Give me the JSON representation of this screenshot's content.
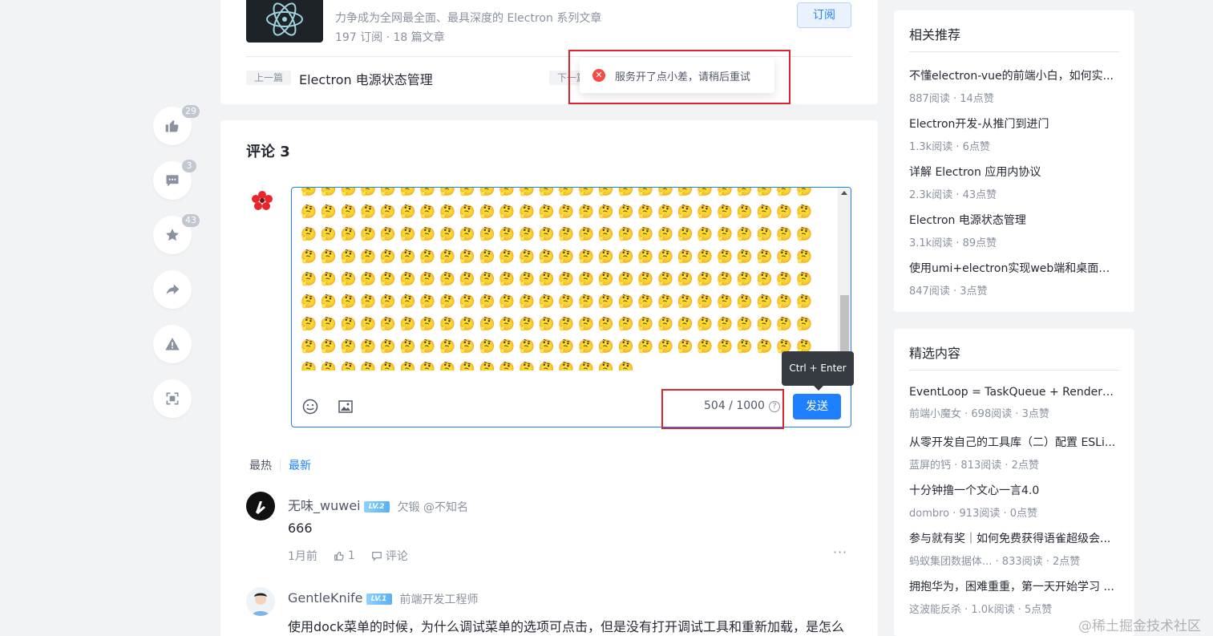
{
  "action_bar": {
    "like_count": "29",
    "comment_count": "3",
    "collect_count": "43"
  },
  "column": {
    "description": "力争成为全网最全面、最具深度的 Electron 系列文章",
    "meta": "197 订阅 · 18 篇文章",
    "subscribe_label": "订阅"
  },
  "article_nav": {
    "prev_tag": "上一篇",
    "prev_title": "Electron 电源状态管理",
    "next_tag": "下一篇"
  },
  "toast": {
    "message": "服务开了点小差，请稍后重试"
  },
  "comments": {
    "title": "评论 3",
    "editor": {
      "content": "🤔🤔🤔🤔🤔🤔🤔🤔🤔🤔🤔🤔🤔🤔🤔🤔🤔🤔🤔🤔🤔🤔🤔🤔🤔🤔🤔🤔🤔🤔🤔🤔🤔🤔🤔🤔🤔🤔🤔🤔🤔🤔🤔🤔🤔🤔🤔🤔🤔🤔🤔🤔🤔🤔🤔🤔🤔🤔🤔🤔🤔🤔🤔🤔🤔🤔🤔🤔🤔🤔🤔🤔🤔🤔🤔🤔🤔🤔🤔🤔🤔🤔🤔🤔🤔🤔🤔🤔🤔🤔🤔🤔🤔🤔🤔🤔🤔🤔🤔🤔🤔🤔🤔🤔🤔🤔🤔🤔🤔🤔🤔🤔🤔🤔🤔🤔🤔🤔🤔🤔🤔🤔🤔🤔🤔🤔🤔🤔🤔🤔🤔🤔🤔🤔🤔🤔🤔🤔🤔🤔🤔🤔🤔🤔🤔🤔🤔🤔🤔🤔🤔🤔🤔🤔🤔🤔🤔🤔🤔🤔🤔🤔🤔🤔🤔🤔🤔🤔🤔🤔🤔🤔🤔🤔🤔🤔🤔🤔🤔🤔🤔🤔🤔🤔🤔🤔🤔🤔🤔🤔🤔🤔🤔🤔🤔🤔🤔🤔🤔🤔🤔🤔🤔🤔🤔🤔🤔🤔🤔🤔🤔🤔🤔🤔🤔🤔🤔🤔🤔🤔🤔🤔🤔🤔🤔",
      "counter": "504 / 1000",
      "send_label": "发送",
      "tooltip": "Ctrl + Enter"
    },
    "sort": {
      "hot": "最热",
      "new": "最新"
    },
    "items": [
      {
        "username": "无味_wuwei",
        "level": "LV.2",
        "job": "欠锻 @不知名",
        "text": "666",
        "time": "1月前",
        "likes": "1",
        "reply_label": "评论"
      },
      {
        "username": "GentleKnife",
        "level": "LV.1",
        "job": "前端开发工程师",
        "text": "使用dock菜单的时候，为什么调试菜单的选项可点击，但是没有打开调试工具和重新加载，是怎么"
      }
    ]
  },
  "sidebar": {
    "related": {
      "title": "相关推荐",
      "items": [
        {
          "title": "不懂electron-vue的前端小白，如何实...",
          "meta": "887阅读 · 14点赞"
        },
        {
          "title": "Electron开发-从推门到进门",
          "meta": "1.3k阅读 · 6点赞"
        },
        {
          "title": "详解 Electron 应用内协议",
          "meta": "2.3k阅读 · 43点赞"
        },
        {
          "title": "Electron 电源状态管理",
          "meta": "3.1k阅读 · 89点赞"
        },
        {
          "title": "使用umi+electron实现web端和桌面端...",
          "meta": "847阅读 · 3点赞"
        }
      ]
    },
    "featured": {
      "title": "精选内容",
      "items": [
        {
          "title": "EventLoop = TaskQueue + RenderQu...",
          "meta": "前端小魔女 · 698阅读 · 3点赞"
        },
        {
          "title": "从零开发自己的工具库（二）配置 ESLi...",
          "meta": "蓝屏的钙 · 813阅读 · 2点赞"
        },
        {
          "title": "十分钟撸一个文心一言4.0",
          "meta": "dombro · 913阅读 · 0点赞"
        },
        {
          "title": "参与就有奖｜如何免费获得语雀超级会...",
          "meta": "蚂蚁集团数据体...   · 833阅读 · 2点赞"
        },
        {
          "title": "拥抱华为，困难重重，第一天开始学习 ...",
          "meta": "这波能反杀 · 1.0k阅读 · 5点赞"
        }
      ]
    }
  },
  "watermark": "@稀土掘金技术社区"
}
